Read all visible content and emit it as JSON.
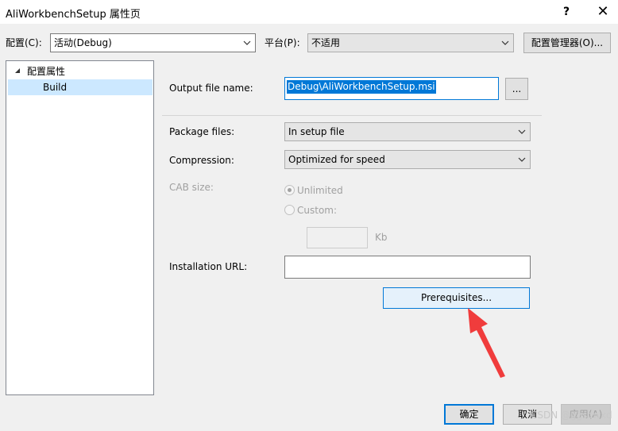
{
  "window": {
    "title": "AliWorkbenchSetup 属性页",
    "help_glyph": "?",
    "close_glyph": "✕"
  },
  "toolbar": {
    "config_label": "配置(C):",
    "config_value": "活动(Debug)",
    "platform_label": "平台(P):",
    "platform_value": "不适用",
    "config_manager_label": "配置管理器(O)..."
  },
  "tree": {
    "root_label": "配置属性",
    "items": [
      {
        "label": "Build"
      }
    ]
  },
  "build": {
    "output_file_label": "Output file name:",
    "output_file_value": "Debug\\AliWorkbenchSetup.msi",
    "browse_label": "...",
    "package_files_label": "Package files:",
    "package_files_value": "In setup file",
    "compression_label": "Compression:",
    "compression_value": "Optimized for speed",
    "cab_size_label": "CAB size:",
    "unlimited_label": "Unlimited",
    "custom_label": "Custom:",
    "cab_unit": "Kb",
    "installation_url_label": "Installation URL:",
    "installation_url_value": "",
    "prerequisites_label": "Prerequisites..."
  },
  "footer": {
    "ok_label": "确定",
    "cancel_label": "取消",
    "apply_label": "应用(A)"
  },
  "watermark": "CSDN @ggscwxd",
  "colors": {
    "accent": "#0078d7",
    "selection_bg": "#cce8ff",
    "annotation_arrow": "#f03c3c"
  }
}
